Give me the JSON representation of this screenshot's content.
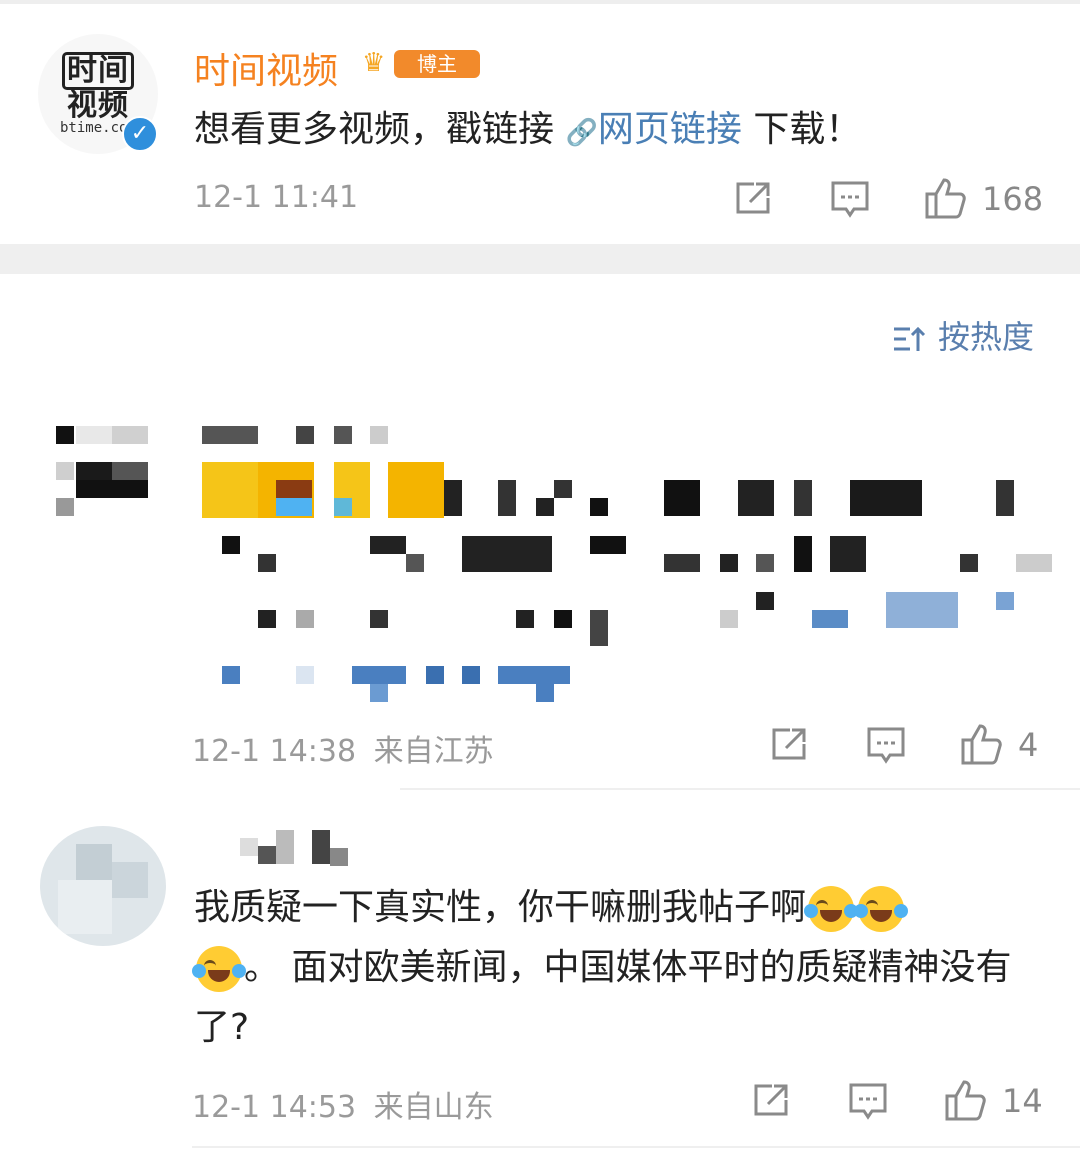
{
  "post": {
    "username": "时间视频",
    "badge": "博主",
    "avatar_logo_line1": "时间",
    "avatar_logo_line2": "视频",
    "avatar_site": "btime.co",
    "text_before_link": "想看更多视频，戳链接",
    "link_icon": "🔗",
    "link_text": "网页链接",
    "text_after_link": "下载！",
    "timestamp": "12-1 11:41",
    "likes": "168"
  },
  "sort": {
    "label": "按热度"
  },
  "comments": [
    {
      "timestamp": "12-1 14:38",
      "location": "来自江苏",
      "likes": "4",
      "pixelated": true
    },
    {
      "text_part1": "我质疑一下真实性，你干嘛删我帖子啊",
      "text_part2": "。 面对欧美新闻，中国媒体平时的质疑精神没有了?",
      "emoji": "laugh-cry-emoji",
      "timestamp": "12-1 14:53",
      "location": "来自山东",
      "likes": "14"
    }
  ],
  "colors": {
    "username": "#f58220",
    "link": "#4a7fb5",
    "sort": "#5a7fae",
    "meta": "#9a9a9a",
    "verified": "#2f8fdc"
  }
}
